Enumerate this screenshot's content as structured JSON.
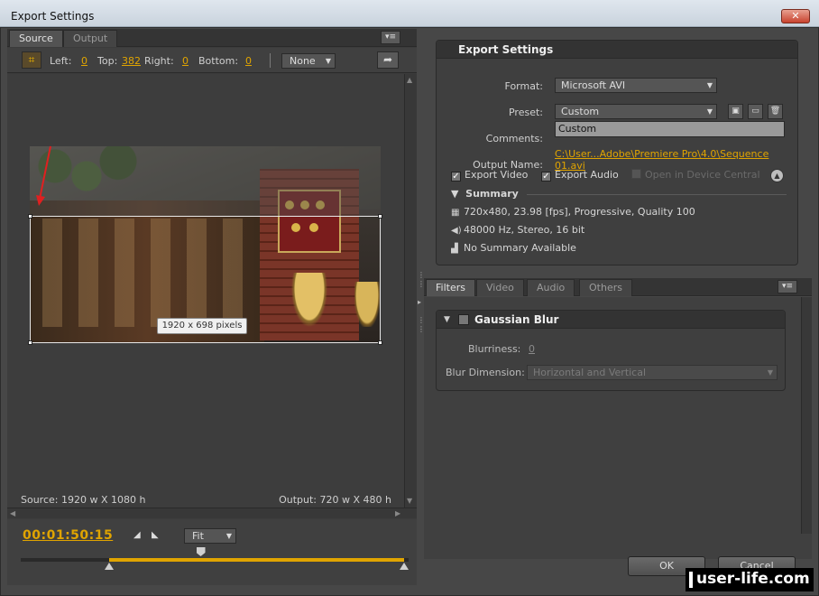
{
  "window": {
    "title": "Export Settings",
    "close_glyph": "✕"
  },
  "left": {
    "tabs": [
      {
        "label": "Source"
      },
      {
        "label": "Output"
      }
    ],
    "crop": {
      "left_label": "Left:",
      "left_value": "0",
      "top_label": "Top:",
      "top_value": "382",
      "right_label": "Right:",
      "right_value": "0",
      "bottom_label": "Bottom:",
      "bottom_value": "0",
      "aspect_value": "None"
    },
    "crop_size_tag": "1920 x 698 pixels",
    "source_info": "Source: 1920 w X 1080 h",
    "output_info": "Output: 720 w X 480 h",
    "timecode": "00:01:50:15",
    "zoom_value": "Fit",
    "playback": {
      "in_fraction": 0.229,
      "playhead_fraction": 0.464,
      "out_fraction": 1.0
    }
  },
  "export_settings": {
    "header": "Export Settings",
    "format_label": "Format:",
    "format_value": "Microsoft AVI",
    "preset_label": "Preset:",
    "preset_value": "Custom",
    "comments_label": "Comments:",
    "comments_value": "Custom",
    "output_name_label": "Output Name:",
    "output_name_value": "C:\\User...Adobe\\Premiere Pro\\4.0\\Sequence 01.avi",
    "export_video_label": "Export Video",
    "export_audio_label": "Export Audio",
    "device_central_label": "Open in Device Central",
    "summary_label": "Summary",
    "summary": [
      {
        "icon": "film-icon",
        "text": "720x480, 23.98 [fps], Progressive, Quality 100"
      },
      {
        "icon": "speaker-icon",
        "text": "48000 Hz, Stereo, 16 bit"
      },
      {
        "icon": "chart-icon",
        "text": "No Summary Available"
      }
    ]
  },
  "filters": {
    "tabs": [
      {
        "label": "Filters"
      },
      {
        "label": "Video"
      },
      {
        "label": "Audio"
      },
      {
        "label": "Others"
      }
    ],
    "gaussian": {
      "title": "Gaussian Blur",
      "blurriness_label": "Blurriness:",
      "blurriness_value": "0",
      "dimension_label": "Blur Dimension:",
      "dimension_value": "Horizontal and Vertical"
    }
  },
  "buttons": {
    "ok": "OK",
    "cancel": "Cancel"
  },
  "watermark": "user-life.com",
  "colors": {
    "accent": "#e0a400",
    "panel": "#3c3c3c",
    "frame": "#474747"
  }
}
